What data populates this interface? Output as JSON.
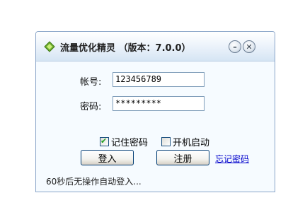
{
  "window": {
    "title": "流量优化精灵 （版本：7.0.0）",
    "minimize_glyph": "–",
    "close_glyph": "✕"
  },
  "form": {
    "account_label": "帐号:",
    "account_value": "123456789",
    "password_label": "密码:",
    "password_value": "*********"
  },
  "options": {
    "remember_password": {
      "label": "记住密码",
      "checked": true
    },
    "auto_start": {
      "label": "开机启动",
      "checked": false
    }
  },
  "actions": {
    "login_label": "登入",
    "register_label": "注册",
    "forgot_password_label": "忘记密码"
  },
  "status": {
    "text": "60秒后无操作自动登入..."
  },
  "colors": {
    "link": "#0000cc",
    "title_gradient_bottom": "#d6e5f4",
    "window_border": "#8aa5c9"
  },
  "icons": {
    "app": "green-diamond-icon",
    "checkmark": "checkmark-icon"
  }
}
